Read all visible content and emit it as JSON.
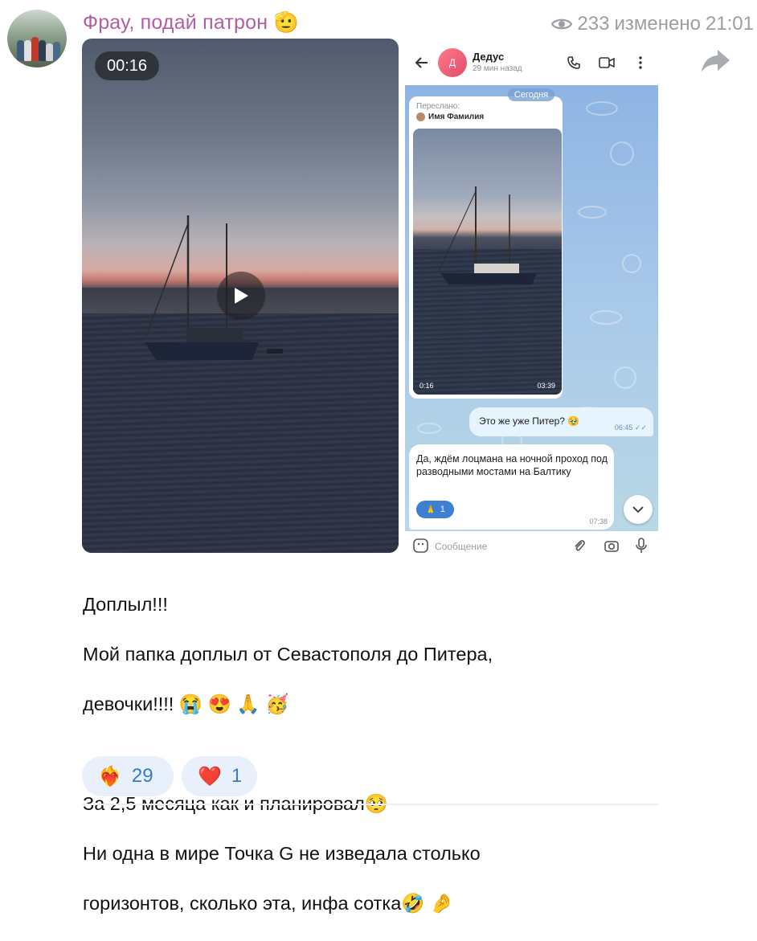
{
  "post": {
    "channel_name": "Фрау, подай патрон",
    "channel_emoji": "🫡",
    "views": "233",
    "edited_label": "изменено",
    "time": "21:01"
  },
  "video": {
    "duration": "00:16"
  },
  "screenshot": {
    "contact_name": "Дедус",
    "contact_initial": "Д",
    "last_seen": "29 мин назад",
    "date_chip": "Сегодня",
    "forwarded_label": "Переслано:",
    "forwarded_name": "Имя Фамилия",
    "video_position": "0:16",
    "video_duration": "03:39",
    "outgoing_text": "Это же уже Питер? 🥹",
    "outgoing_time": "06:45",
    "incoming_text": "Да, ждём лоцмана на ночной проход под разводными мостами на Балтику",
    "incoming_reaction_emoji": "🙏",
    "incoming_reaction_count": "1",
    "incoming_time": "07:38",
    "input_placeholder": "Сообщение"
  },
  "caption": {
    "line1": "Доплыл!!!",
    "line2": "Мой папка доплыл от Севастополя до Питера,",
    "line3": "девочки!!!! 😭 😍 🙏 🥳",
    "line4": "За 2,5 месяца как и планировал🥺",
    "line5": "Ни одна в мире Точка G не изведала столько",
    "line6": "горизонтов, сколько эта, инфа сотка🤣 🤌"
  },
  "reactions": [
    {
      "emoji": "❤️‍🔥",
      "count": "29"
    },
    {
      "emoji": "❤️",
      "count": "1"
    }
  ],
  "colors": {
    "channel_name": "#b05fa3",
    "reaction_text": "#3a7bc8",
    "reaction_bg": "#e8f1fb",
    "meta_gray": "#9b9ea4"
  }
}
